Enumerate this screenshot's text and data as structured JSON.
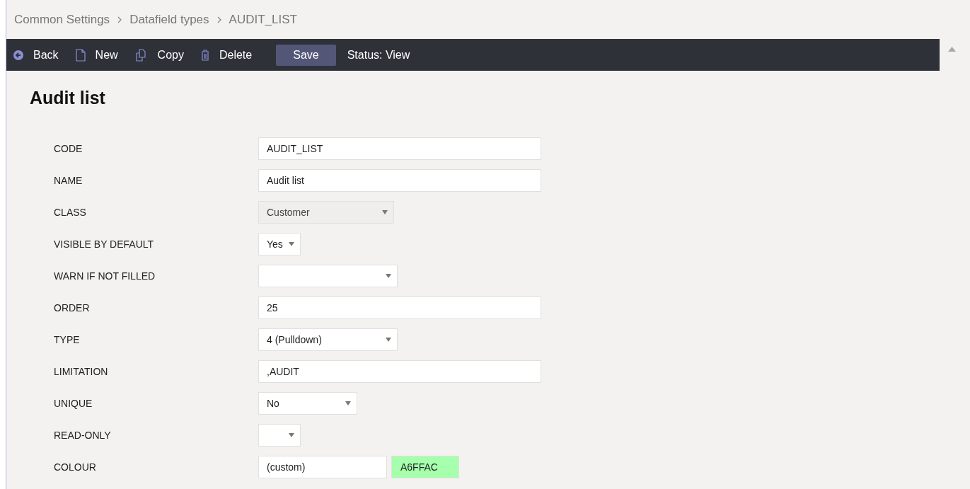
{
  "breadcrumb": [
    "Common Settings",
    "Datafield types",
    "AUDIT_LIST"
  ],
  "toolbar": {
    "actions": [
      {
        "kind": "back",
        "label": "Back"
      },
      {
        "kind": "new",
        "label": "New"
      },
      {
        "kind": "copy",
        "label": "Copy"
      },
      {
        "kind": "delete",
        "label": "Delete"
      },
      {
        "kind": "save",
        "label": "Save"
      }
    ],
    "status": "Status: View"
  },
  "title": "Audit list",
  "fields": [
    {
      "label": "CODE",
      "kind": "text",
      "value": "AUDIT_LIST"
    },
    {
      "label": "NAME",
      "kind": "text",
      "value": "Audit list"
    },
    {
      "label": "CLASS",
      "kind": "select",
      "value": "Customer",
      "disabled": true
    },
    {
      "label": "VISIBLE BY DEFAULT",
      "kind": "select",
      "value": "Yes",
      "disabled": false
    },
    {
      "label": "WARN IF NOT FILLED",
      "kind": "select",
      "disabled": false
    },
    {
      "label": "ORDER",
      "kind": "text",
      "value": "25"
    },
    {
      "label": "TYPE",
      "kind": "select",
      "value": "4 (Pulldown)",
      "disabled": false
    },
    {
      "label": "LIMITATION",
      "kind": "text",
      "value": ",AUDIT"
    },
    {
      "label": "UNIQUE",
      "kind": "select",
      "value": "No",
      "disabled": false
    },
    {
      "label": "READ-ONLY",
      "kind": "select",
      "disabled": false
    },
    {
      "label": "COLOUR",
      "kind": "colour",
      "value": "(custom)",
      "swatch": "A6FFAC",
      "color": "#a6ffac"
    }
  ]
}
